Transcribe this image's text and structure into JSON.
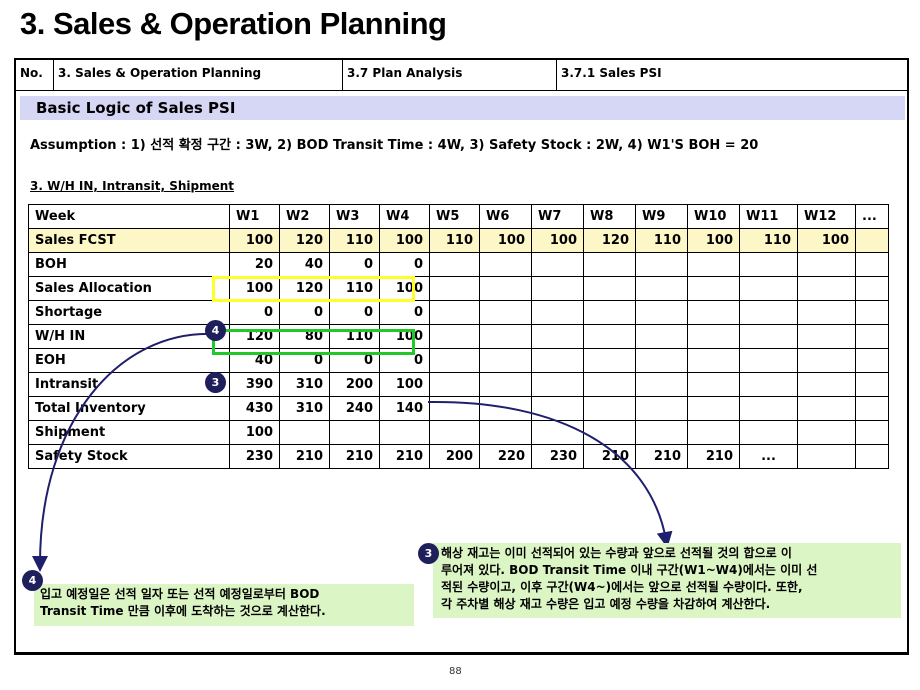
{
  "page_title": "3. Sales & Operation Planning",
  "header": {
    "no": "No.",
    "section": "3. Sales & Operation Planning",
    "sub": "3.7 Plan Analysis",
    "subsub": "3.7.1 Sales PSI"
  },
  "band_title": "Basic Logic of Sales PSI",
  "assumption": "Assumption : 1) 선적 확정 구간 : 3W,  2) BOD Transit Time : 4W,  3) Safety Stock : 2W, 4) W1'S BOH = 20",
  "subhead": "3. W/H IN, Intransit, Shipment",
  "table": {
    "columns": [
      "Week",
      "W1",
      "W2",
      "W3",
      "W4",
      "W5",
      "W6",
      "W7",
      "W8",
      "W9",
      "W10",
      "W11",
      "W12",
      "..."
    ],
    "rows": [
      {
        "label": "Sales FCST",
        "cells": [
          "100",
          "120",
          "110",
          "100",
          "110",
          "100",
          "100",
          "120",
          "110",
          "100",
          "110",
          "100",
          ""
        ]
      },
      {
        "label": "BOH",
        "cells": [
          "20",
          "40",
          "0",
          "0",
          "",
          "",
          "",
          "",
          "",
          "",
          "",
          "",
          ""
        ]
      },
      {
        "label": "Sales Allocation",
        "cells": [
          "100",
          "120",
          "110",
          "100",
          "",
          "",
          "",
          "",
          "",
          "",
          "",
          "",
          ""
        ]
      },
      {
        "label": "Shortage",
        "cells": [
          "0",
          "0",
          "0",
          "0",
          "",
          "",
          "",
          "",
          "",
          "",
          "",
          "",
          ""
        ]
      },
      {
        "label": "W/H IN",
        "cells": [
          "120",
          "80",
          "110",
          "100",
          "",
          "",
          "",
          "",
          "",
          "",
          "",
          "",
          ""
        ]
      },
      {
        "label": "EOH",
        "cells": [
          "40",
          "0",
          "0",
          "0",
          "",
          "",
          "",
          "",
          "",
          "",
          "",
          "",
          ""
        ]
      },
      {
        "label": "Intransit",
        "cells": [
          "390",
          "310",
          "200",
          "100",
          "",
          "",
          "",
          "",
          "",
          "",
          "",
          "",
          ""
        ]
      },
      {
        "label": "Total Inventory",
        "cells": [
          "430",
          "310",
          "240",
          "140",
          "",
          "",
          "",
          "",
          "",
          "",
          "",
          "",
          ""
        ]
      },
      {
        "label": "Shipment",
        "cells": [
          "100",
          "",
          "",
          "",
          "",
          "",
          "",
          "",
          "",
          "",
          "",
          "",
          ""
        ]
      },
      {
        "label": "Safety Stock",
        "cells": [
          "230",
          "210",
          "210",
          "210",
          "200",
          "220",
          "230",
          "210",
          "210",
          "210",
          "...",
          "",
          ""
        ]
      }
    ]
  },
  "badges": {
    "four": "4",
    "three": "3"
  },
  "note_left": {
    "badge": "4",
    "line1": "입고 예정일은 선적 일자 또는 선적 예정일로부터 BOD",
    "line2": "Transit Time 만큼 이후에 도착하는 것으로 계산한다."
  },
  "note_right": {
    "badge": "3",
    "line1": "해상 재고는 이미 선적되어 있는 수량과 앞으로 선적될 것의 합으로 이",
    "line2": "루어져 있다. BOD Transit Time 이내 구간(W1~W4)에서는 이미 선",
    "line3": "적된 수량이고, 이후 구간(W4~)에서는 앞으로 선적될 수량이다. 또한,",
    "line4": "각 주차별 해상 재고 수량은 입고 예정 수량을 차감하여 계산한다."
  },
  "page_number": "88",
  "colors": {
    "band": "#d6d6f5",
    "fcst_row": "#fdf7c8",
    "highlight_yellow": "#ffff2a",
    "highlight_green": "#22c82a",
    "note_bg": "#dcf5c4",
    "arrow": "#1f1f6e"
  }
}
